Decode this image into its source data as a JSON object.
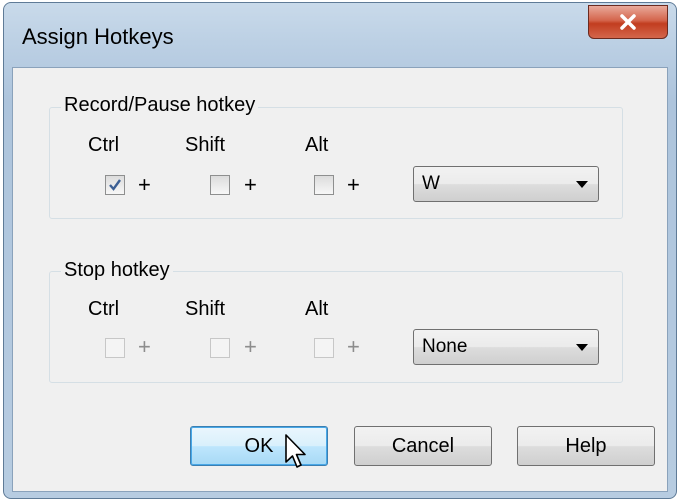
{
  "window": {
    "title": "Assign Hotkeys"
  },
  "record_group": {
    "label": "Record/Pause hotkey",
    "ctrl_label": "Ctrl",
    "shift_label": "Shift",
    "alt_label": "Alt",
    "plus": "+",
    "ctrl_checked": true,
    "shift_checked": false,
    "alt_checked": false,
    "key_value": "W"
  },
  "stop_group": {
    "label": "Stop hotkey",
    "ctrl_label": "Ctrl",
    "shift_label": "Shift",
    "alt_label": "Alt",
    "plus": "+",
    "ctrl_checked": false,
    "shift_checked": false,
    "alt_checked": false,
    "key_value": "None"
  },
  "buttons": {
    "ok": "OK",
    "cancel": "Cancel",
    "help": "Help"
  },
  "icons": {
    "close": "close-icon",
    "dropdown": "chevron-down-icon",
    "check": "checkmark-icon",
    "cursor": "mouse-pointer-icon"
  },
  "colors": {
    "close_button": "#c94a2c",
    "default_button_border": "#3c7fb1"
  }
}
